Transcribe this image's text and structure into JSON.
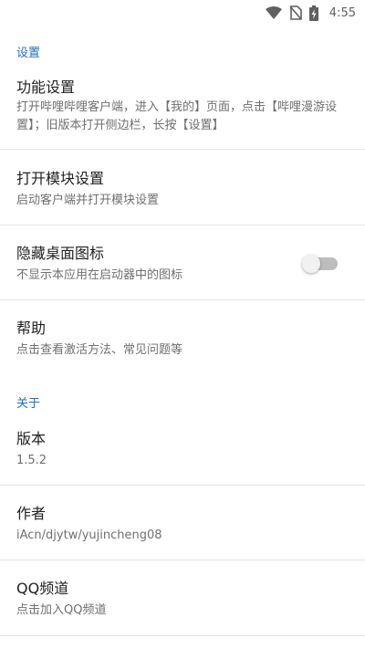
{
  "status_bar": {
    "time": "4:55",
    "icons": [
      "wifi-icon",
      "no-sim-icon",
      "battery-charging-icon"
    ]
  },
  "sections": {
    "settings_header": "设置",
    "about_header": "关于"
  },
  "prefs": {
    "function_settings": {
      "title": "功能设置",
      "summary": "打开哔哩哔哩客户端，进入【我的】页面，点击【哔哩漫游设置】；旧版本打开侧边栏，长按【设置】"
    },
    "open_module_settings": {
      "title": "打开模块设置",
      "summary": "启动客户端并打开模块设置"
    },
    "hide_launcher_icon": {
      "title": "隐藏桌面图标",
      "summary": "不显示本应用在启动器中的图标",
      "enabled": false
    },
    "help": {
      "title": "帮助",
      "summary": "点击查看激活方法、常见问题等"
    },
    "version": {
      "title": "版本",
      "summary": "1.5.2"
    },
    "author": {
      "title": "作者",
      "summary": "iAcn/djytw/yujincheng08"
    },
    "qq_channel": {
      "title": "QQ频道",
      "summary": "点击加入QQ频道"
    }
  },
  "colors": {
    "accent": "#1f6fc9",
    "title_text": "#212121",
    "summary_text": "#6f6f6f",
    "divider": "#e3e3e3",
    "switch_off_track": "#bdbdbd"
  }
}
